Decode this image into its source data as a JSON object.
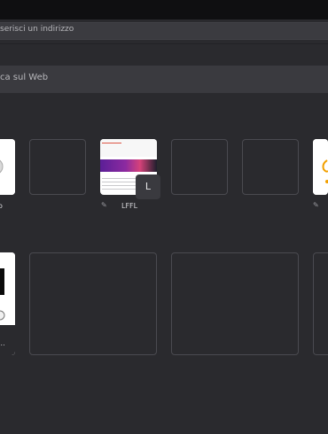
{
  "urlbar": {
    "placeholder": "serisci un indirizzo"
  },
  "search": {
    "placeholder": "ca sul Web"
  },
  "tiles": {
    "row1": [
      {
        "label": "o"
      },
      {
        "label": ""
      },
      {
        "label": "LFFL",
        "badge": "L"
      },
      {
        "label": ""
      },
      {
        "label": ""
      },
      {
        "label": ""
      }
    ],
    "row2": [
      {
        "label": "..."
      },
      {
        "label": ""
      },
      {
        "label": ""
      },
      {
        "label": ""
      }
    ]
  },
  "icons": {
    "pin": "pin-icon"
  },
  "colors": {
    "background": "#2a2a2e",
    "topbar": "#0f0f11",
    "urlbar": "#3b3b40",
    "tile_border": "#4a4a50",
    "banner_purple": "#5b1f97",
    "banner_pink": "#d6427a"
  }
}
